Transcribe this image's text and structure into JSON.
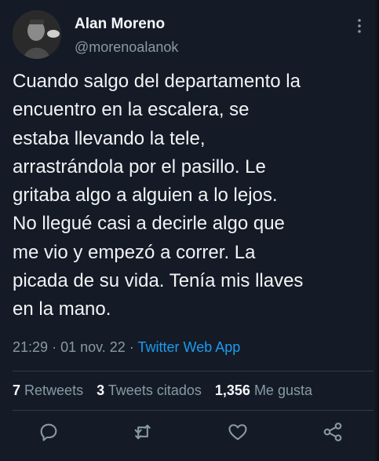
{
  "author": {
    "name": "Alan Moreno",
    "handle": "@morenoalanok"
  },
  "tweet": {
    "text": "Cuando salgo del departamento la\nencuentro en la escalera, se\nestaba llevando la tele,\narrastrándola por el pasillo. Le\ngritaba algo a alguien a lo lejos.\nNo llegué casi a decirle algo que\nme vio y empezó a correr. La\npicada de su vida. Tenía mis llaves\nen la mano.",
    "time": "21:29",
    "separator": "·",
    "date": "01 nov. 22",
    "source": "Twitter Web App"
  },
  "stats": {
    "retweets_count": "7",
    "retweets_label": "Retweets",
    "quotes_count": "3",
    "quotes_label": "Tweets citados",
    "likes_count": "1,356",
    "likes_label": "Me gusta"
  },
  "icons": {
    "more": "more-vertical-icon",
    "reply": "reply-icon",
    "retweet": "retweet-icon",
    "like": "heart-icon",
    "share": "share-icon"
  },
  "colors": {
    "background": "#141b26",
    "accent": "#1d9bf0",
    "secondary_text": "#8899a6",
    "primary_text": "#f1f3f5"
  }
}
